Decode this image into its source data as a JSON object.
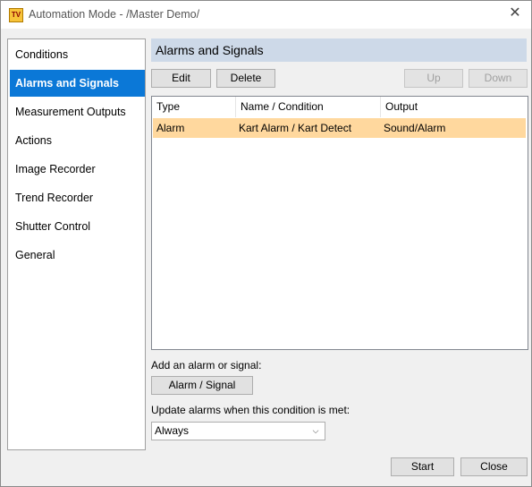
{
  "window": {
    "title": "Automation Mode - /Master Demo/",
    "app_icon_text": "TV"
  },
  "sidebar": {
    "items": [
      {
        "label": "Conditions"
      },
      {
        "label": "Alarms and Signals"
      },
      {
        "label": "Measurement Outputs"
      },
      {
        "label": "Actions"
      },
      {
        "label": "Image Recorder"
      },
      {
        "label": "Trend Recorder"
      },
      {
        "label": "Shutter Control"
      },
      {
        "label": "General"
      }
    ],
    "selected": "Alarms and Signals"
  },
  "panel": {
    "title": "Alarms and Signals",
    "toolbar": {
      "edit": "Edit",
      "delete": "Delete",
      "up": "Up",
      "down": "Down"
    },
    "table": {
      "columns": [
        "Type",
        "Name / Condition",
        "Output"
      ],
      "rows": [
        {
          "type": "Alarm",
          "name": "Kart Alarm / Kart Detect",
          "output": "Sound/Alarm"
        }
      ]
    },
    "add_label": "Add an alarm or signal:",
    "add_button": "Alarm / Signal",
    "update_label": "Update alarms when this condition is met:",
    "update_select": {
      "value": "Always"
    }
  },
  "footer": {
    "start": "Start",
    "close": "Close"
  },
  "colors": {
    "accent": "#0b78d7",
    "header_bg": "#cdd9e8",
    "row_highlight": "#ffd89e"
  }
}
